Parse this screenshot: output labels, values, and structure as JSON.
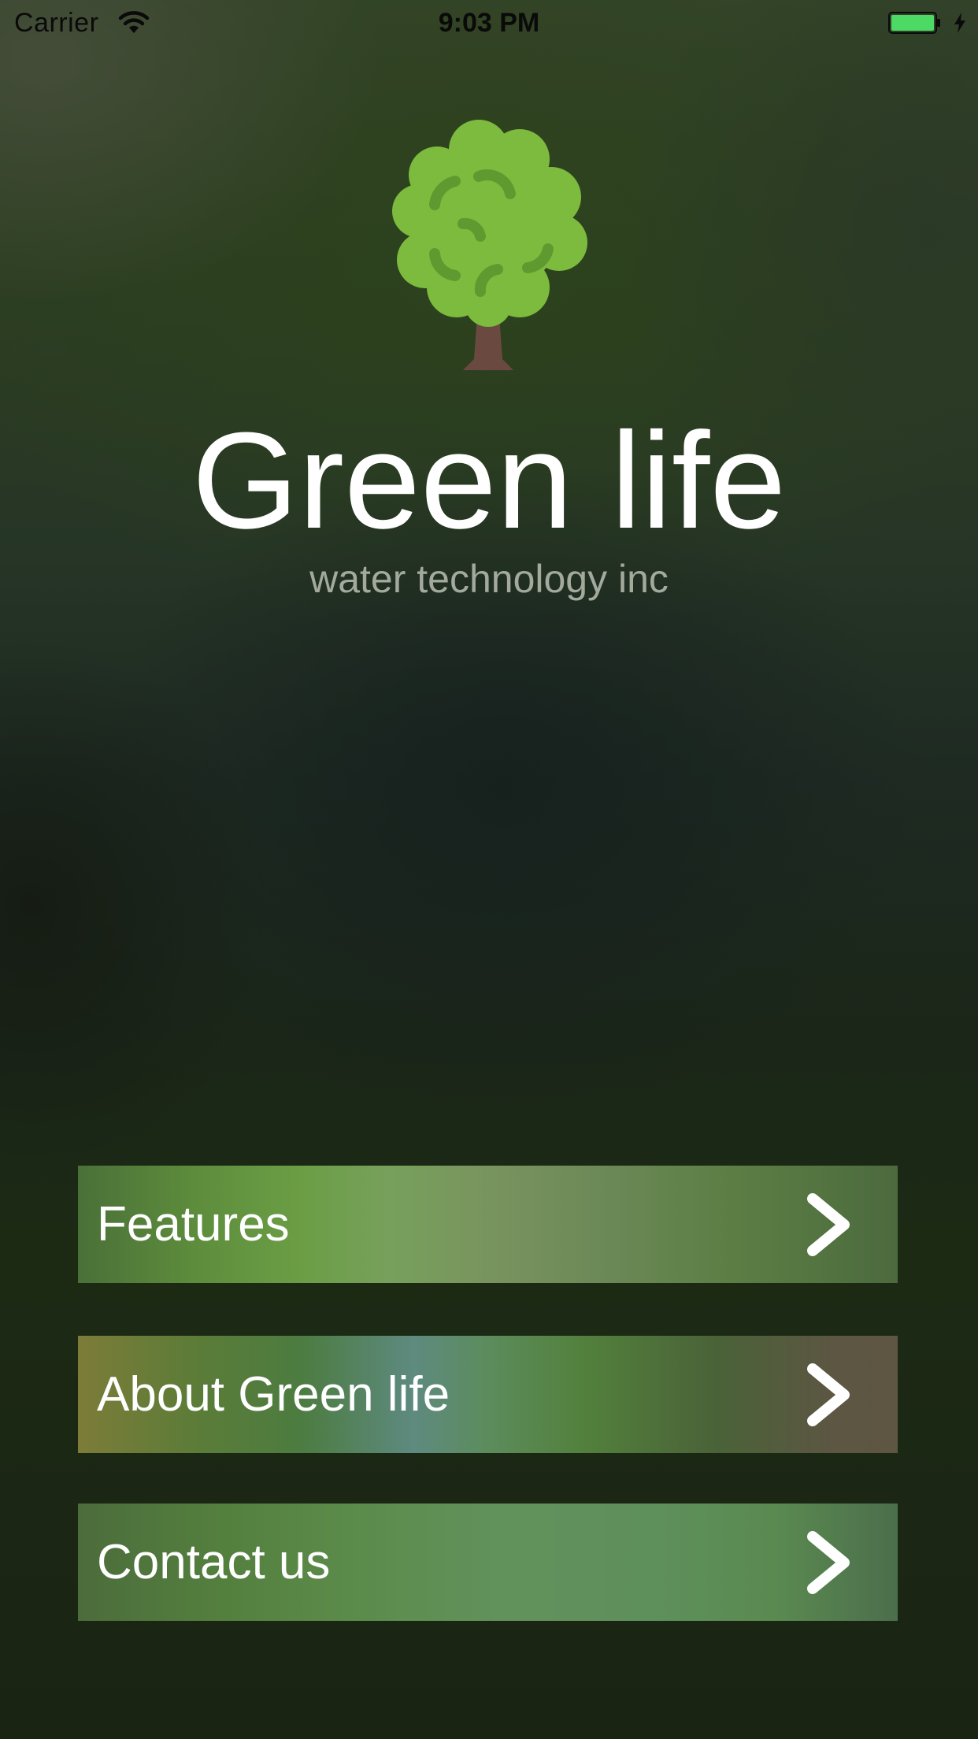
{
  "status_bar": {
    "carrier": "Carrier",
    "time": "9:03 PM",
    "battery_color": "#4cd964",
    "icons": [
      "wifi-icon",
      "battery-icon",
      "charging-bolt-icon"
    ]
  },
  "hero": {
    "logo_icon": "tree-icon",
    "title": "Green life",
    "subtitle": "water technology inc",
    "logo_colors": {
      "foliage": "#7cbb3e",
      "foliage_detail": "#5f9a30",
      "trunk": "#6a4a40"
    }
  },
  "menu": {
    "items": [
      {
        "label": "Features",
        "icon": "chevron-right-icon"
      },
      {
        "label": "About Green life",
        "icon": "chevron-right-icon"
      },
      {
        "label": "Contact us",
        "icon": "chevron-right-icon"
      }
    ]
  }
}
